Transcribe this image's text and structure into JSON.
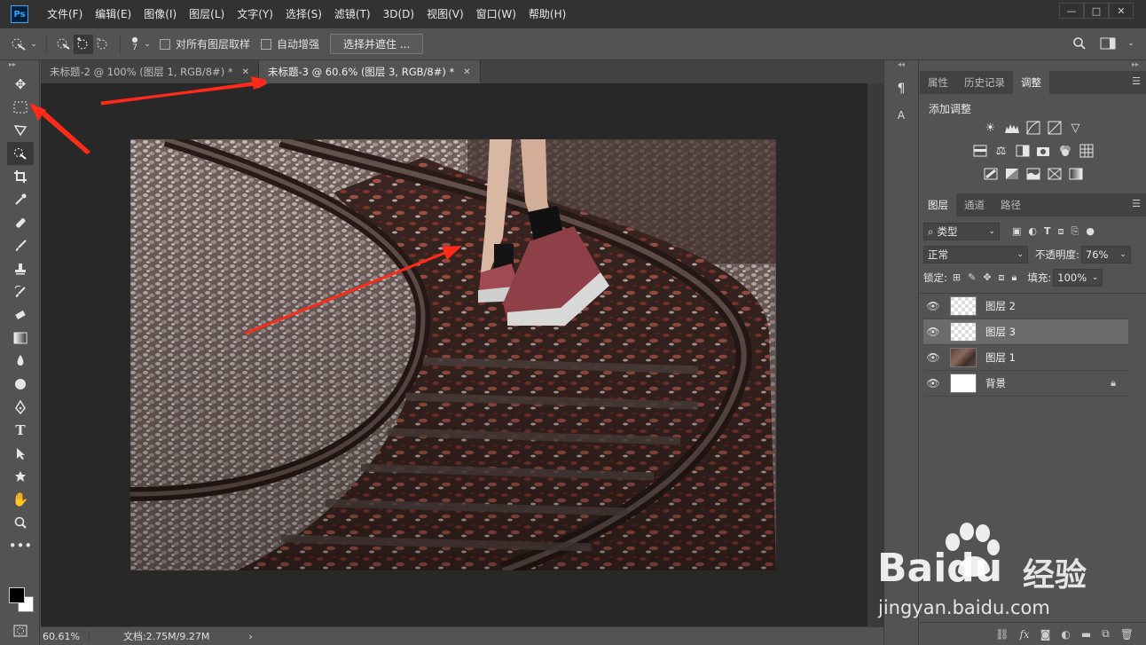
{
  "app": {
    "logo": "Ps"
  },
  "menu": [
    "文件(F)",
    "编辑(E)",
    "图像(I)",
    "图层(L)",
    "文字(Y)",
    "选择(S)",
    "滤镜(T)",
    "3D(D)",
    "视图(V)",
    "窗口(W)",
    "帮助(H)"
  ],
  "window_controls": {
    "minimize": "—",
    "restore": "□",
    "close": "✕"
  },
  "options": {
    "brush_size": "7",
    "sample_all_layers": "对所有图层取样",
    "auto_enhance": "自动增强",
    "select_and_mask": "选择并遮住 ..."
  },
  "tabs": [
    {
      "label": "未标题-2 @ 100% (图层 1, RGB/8#) *",
      "close": "✕"
    },
    {
      "label": "未标题-3 @ 60.6% (图层 3, RGB/8#) *",
      "close": "✕"
    }
  ],
  "status": {
    "zoom": "60.61%",
    "doc": "文档:2.75M/9.27M",
    "arrow": "›"
  },
  "right_panels": {
    "top_tabs": [
      "属性",
      "历史记录",
      "调整"
    ],
    "adjust_title": "添加调整",
    "layer_tabs": [
      "图层",
      "通道",
      "路径"
    ],
    "filter_kind": "类型",
    "blend_mode": "正常",
    "opacity_label": "不透明度:",
    "opacity_value": "76%",
    "lock_label": "锁定:",
    "fill_label": "填充:",
    "fill_value": "100%",
    "layers": [
      {
        "name": "图层 2",
        "thumb": "checker",
        "selected": false,
        "locked": false
      },
      {
        "name": "图层 3",
        "thumb": "checker",
        "selected": true,
        "locked": false
      },
      {
        "name": "图层 1",
        "thumb": "photo",
        "selected": false,
        "locked": false
      },
      {
        "name": "背景",
        "thumb": "white",
        "selected": false,
        "locked": true
      }
    ]
  },
  "watermark": {
    "site": "jingyan.baidu.com",
    "brand": "Baidu",
    "brand_cn": "经验"
  },
  "colors": {
    "accent": "#31a8ff",
    "annotation_arrow": "#ff2a1a"
  }
}
